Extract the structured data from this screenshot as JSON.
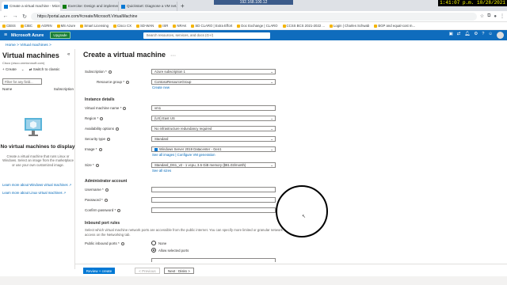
{
  "banner": {
    "host": "192.168.100.12",
    "clock": "1:41:07 p.m. 10/28/2021"
  },
  "browser": {
    "tabs": [
      {
        "label": "Create a virtual machine - Micros...",
        "color": "#0078d4",
        "active": true
      },
      {
        "label": "Exercise: Design and implement...",
        "color": "#107c10",
        "active": false
      },
      {
        "label": "Quickstart: Diagnose a VM net...",
        "color": "#0078d4",
        "active": false
      }
    ],
    "new_tab": "+",
    "url": "https://portal.azure.com/#create/Microsoft.VirtualMachine",
    "bookmarks": [
      "CBSS",
      "CIBC",
      "AGRIN",
      "MS Azure",
      "Smart Licensing",
      "Cisco CX",
      "SD-WAN",
      "ISR",
      "NRAK",
      "SD CLARO | Extra Effort",
      "Doc Exchange | CLARO",
      "CCSS BCS 2021-2022 ...",
      "Login | Charles Schwab",
      "BGP and equal-cost m..."
    ]
  },
  "azure": {
    "brand": "Microsoft Azure",
    "upgrade": "Upgrade",
    "search_placeholder": "Search resources, services, and docs (G+/)"
  },
  "breadcrumb": "Home  >  Virtual machines  >",
  "left": {
    "title": "Virtual machines",
    "subtitle": "Cisco (cisco.onmicrosoft.com)",
    "create": "+ Create",
    "switch": "Switch to classic",
    "filter_placeholder": "Filter for any field...",
    "col_name": "Name",
    "col_sub": "Subscription",
    "empty_title": "No virtual machines to display",
    "empty_desc": "Create a virtual machine that runs Linux or Windows. Select an image from the marketplace or use your own customized image.",
    "link_windows": "Learn more about Windows virtual machines",
    "link_linux": "Learn more about Linux virtual machines"
  },
  "main": {
    "title": "Create a virtual machine",
    "subscription_label": "Subscription *",
    "subscription_value": "Azure subscription 1",
    "rg_label": "Resource group *",
    "rg_value": "ContosoResourceGroup",
    "create_new": "Create new",
    "instance_section": "Instance details",
    "vmname_label": "Virtual machine name *",
    "vmname_value": "vm1",
    "region_label": "Region *",
    "region_value": "(US) East US",
    "avail_label": "Availability options",
    "avail_value": "No infrastructure redundancy required",
    "security_label": "Security type",
    "security_value": "Standard",
    "image_label": "Image *",
    "image_value": "Windows Server 2019 Datacenter - Gen1",
    "image_links": "See all images | Configure VM generation",
    "size_label": "Size *",
    "size_value": "Standard_DS1_v2 - 1 vcpu, 3.5 GiB memory ($81.03/month)",
    "size_link": "See all sizes",
    "admin_section": "Administrator account",
    "username_label": "Username *",
    "password_label": "Password *",
    "confirm_label": "Confirm password *",
    "inbound_section": "Inbound port rules",
    "inbound_desc": "Select which virtual machine network ports are accessible from the public internet. You can specify more limited or granular network access on the Networking tab.",
    "public_ports_label": "Public inbound ports *",
    "radio_none": "None",
    "radio_allow": "Allow selected ports"
  },
  "footer": {
    "review": "Review + create",
    "previous": "< Previous",
    "next": "Next : Disks >"
  }
}
